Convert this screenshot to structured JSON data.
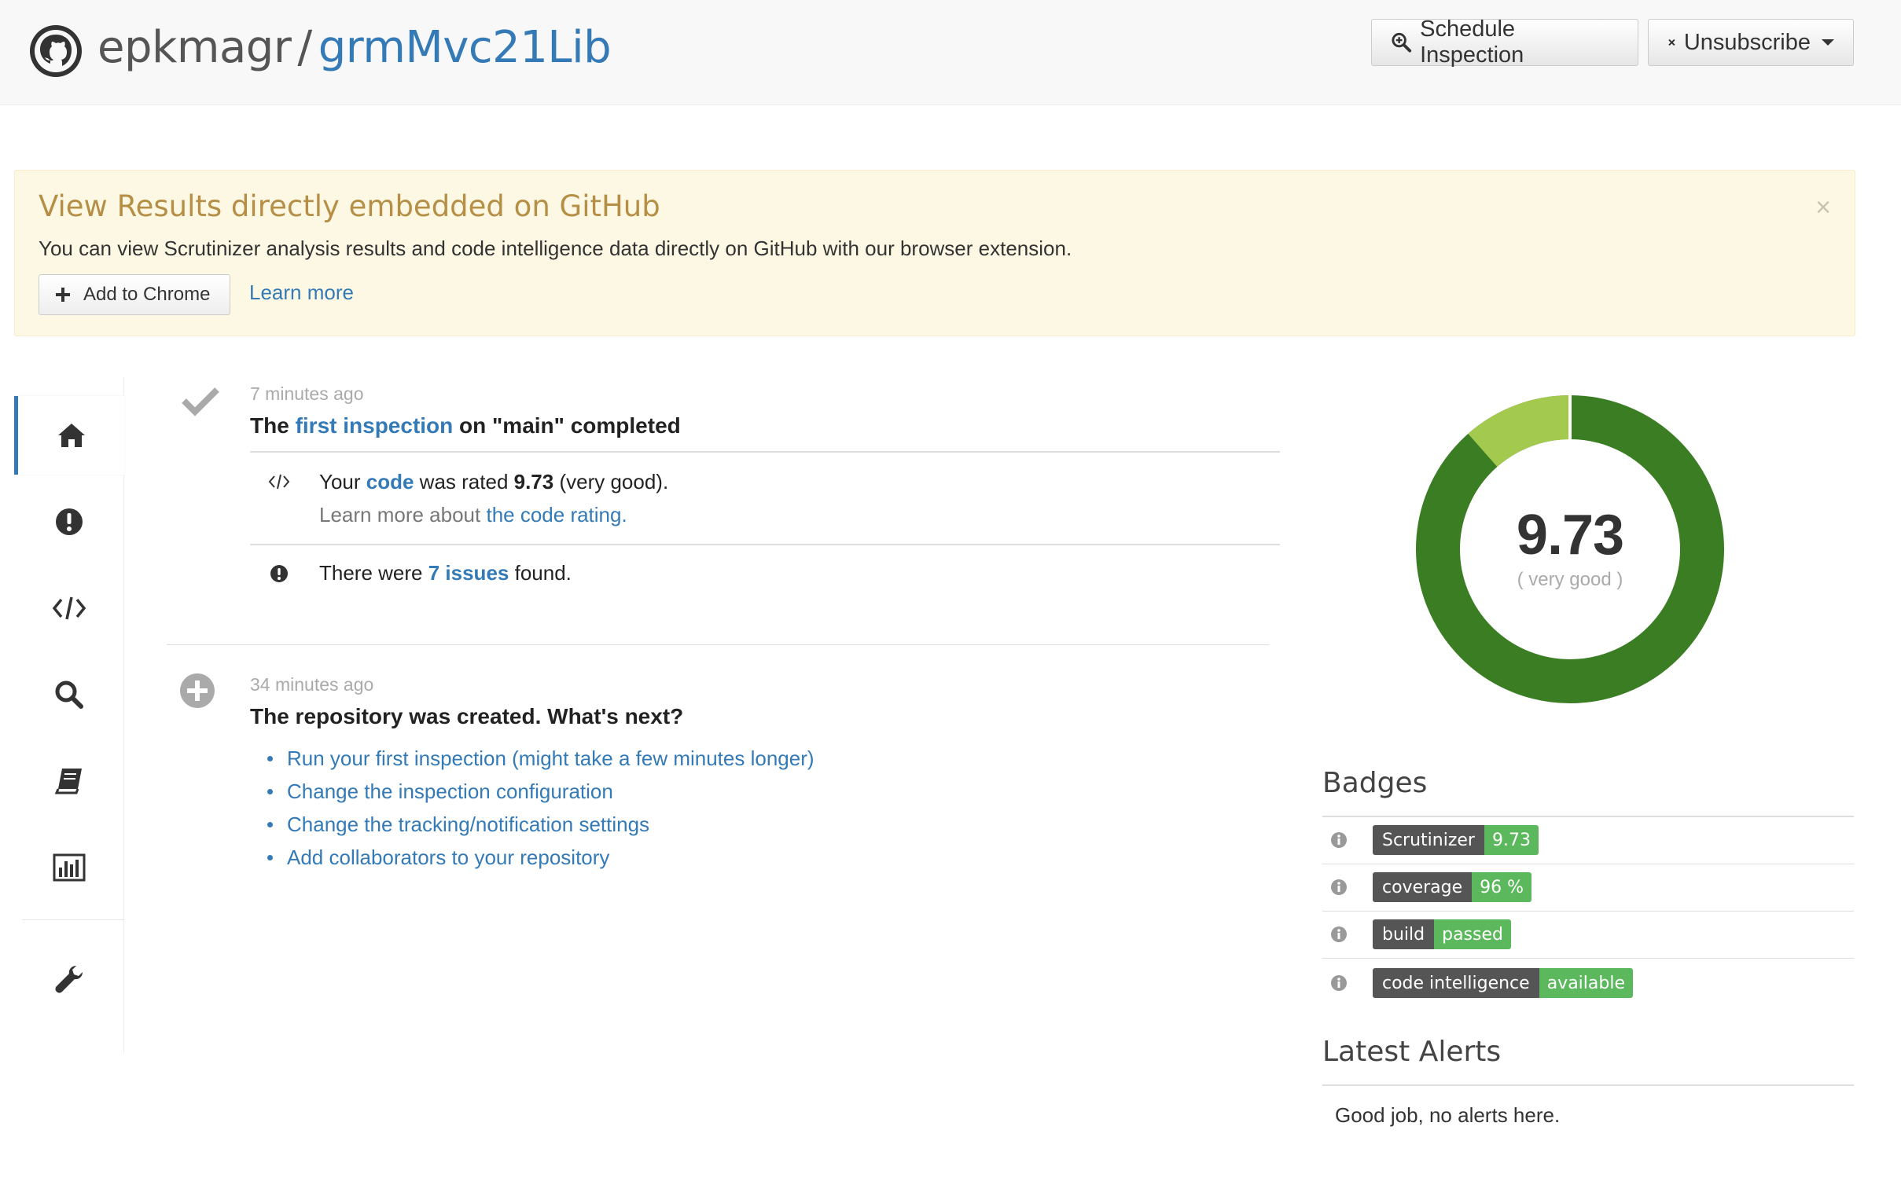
{
  "header": {
    "owner": "epkmagr",
    "separator": "/",
    "repo": "grmMvc21Lib",
    "schedule_label": "Schedule Inspection",
    "unsubscribe_label": "Unsubscribe"
  },
  "alert": {
    "title": "View Results directly embedded on GitHub",
    "text": "You can view Scrutinizer analysis results and code intelligence data directly on GitHub with our browser extension.",
    "close": "×",
    "add_button": "Add to Chrome",
    "learn_more": "Learn more"
  },
  "sidebar": {
    "items": [
      "home-icon",
      "issues-icon",
      "code-icon",
      "search-icon",
      "book-icon",
      "statistics-icon",
      "wrench-icon"
    ],
    "active": "home-icon"
  },
  "events": [
    {
      "time": "7 minutes ago",
      "title_pre": "The ",
      "title_link": "first inspection",
      "title_post": " on \"main\" completed",
      "rating_pre": "Your ",
      "rating_link": "code",
      "rating_mid": " was rated ",
      "rating_value": "9.73",
      "rating_post": " (very good).",
      "learn_pre": "Learn more about ",
      "learn_link": "the code rating.",
      "issues_pre": "There were ",
      "issues_link": "7 issues",
      "issues_post": " found."
    },
    {
      "time": "34 minutes ago",
      "title": "The repository was created. What's next?",
      "next_steps": [
        "Run your first inspection (might take a few minutes longer)",
        "Change the inspection configuration",
        "Change the tracking/notification settings",
        "Add collaborators to your repository"
      ]
    }
  ],
  "score": {
    "value": "9.73",
    "label": "( very good )",
    "fraction_dark_green": 0.885,
    "fraction_light_green": 0.115,
    "colors": {
      "dark": "#3b7d23",
      "light": "#a3c94f"
    }
  },
  "badges": {
    "heading": "Badges",
    "items": [
      {
        "left": "Scrutinizer",
        "right": "9.73"
      },
      {
        "left": "coverage",
        "right": "96 %"
      },
      {
        "left": "build",
        "right": "passed"
      },
      {
        "left": "code intelligence",
        "right": "available"
      }
    ]
  },
  "alerts": {
    "heading": "Latest Alerts",
    "text": "Good job, no alerts here."
  }
}
